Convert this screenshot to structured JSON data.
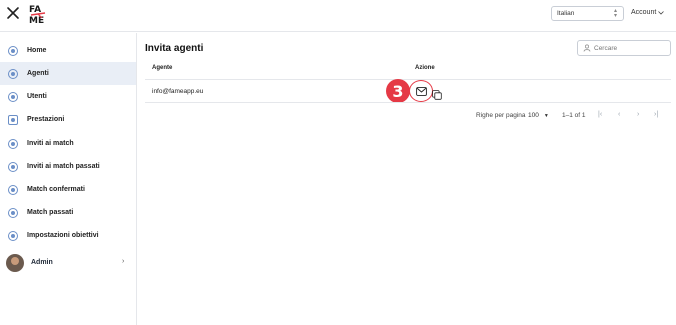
{
  "header": {
    "language": "Italian",
    "account_label": "Account",
    "icons": {
      "close": "close-icon",
      "language_chevron": "chevron-updown-icon",
      "account_chevron": "chevron-down-icon"
    }
  },
  "sidebar": {
    "items": [
      {
        "label": "Home",
        "icon": "home-icon",
        "active": false
      },
      {
        "label": "Agenti",
        "icon": "person-icon",
        "active": true
      },
      {
        "label": "Utenti",
        "icon": "person-icon",
        "active": false
      },
      {
        "label": "Prestazioni",
        "icon": "chart-icon",
        "active": false
      },
      {
        "label": "Inviti ai match",
        "icon": "match-icon",
        "active": false
      },
      {
        "label": "Inviti ai match passati",
        "icon": "match-icon",
        "active": false
      },
      {
        "label": "Match confermati",
        "icon": "match-icon",
        "active": false
      },
      {
        "label": "Match passati",
        "icon": "match-icon",
        "active": false
      },
      {
        "label": "Impostazioni obiettivi",
        "icon": "settings-icon",
        "active": false
      }
    ],
    "user": {
      "name": "Admin"
    }
  },
  "main": {
    "title": "Invita agenti",
    "search": {
      "placeholder": "Cercare",
      "value": ""
    },
    "table": {
      "columns": [
        "Agente",
        "Azione"
      ],
      "rows": [
        {
          "email": "info@fameapp.eu"
        }
      ]
    },
    "step_badge": "3",
    "pagination": {
      "rows_per_page_label": "Righe per pagina",
      "rows_per_page_value": "100",
      "range": "1–1 of 1"
    }
  },
  "colors": {
    "accent_red": "#e53945",
    "active_bg": "#e9eef6",
    "icon_blue": "#6b8fc7"
  }
}
